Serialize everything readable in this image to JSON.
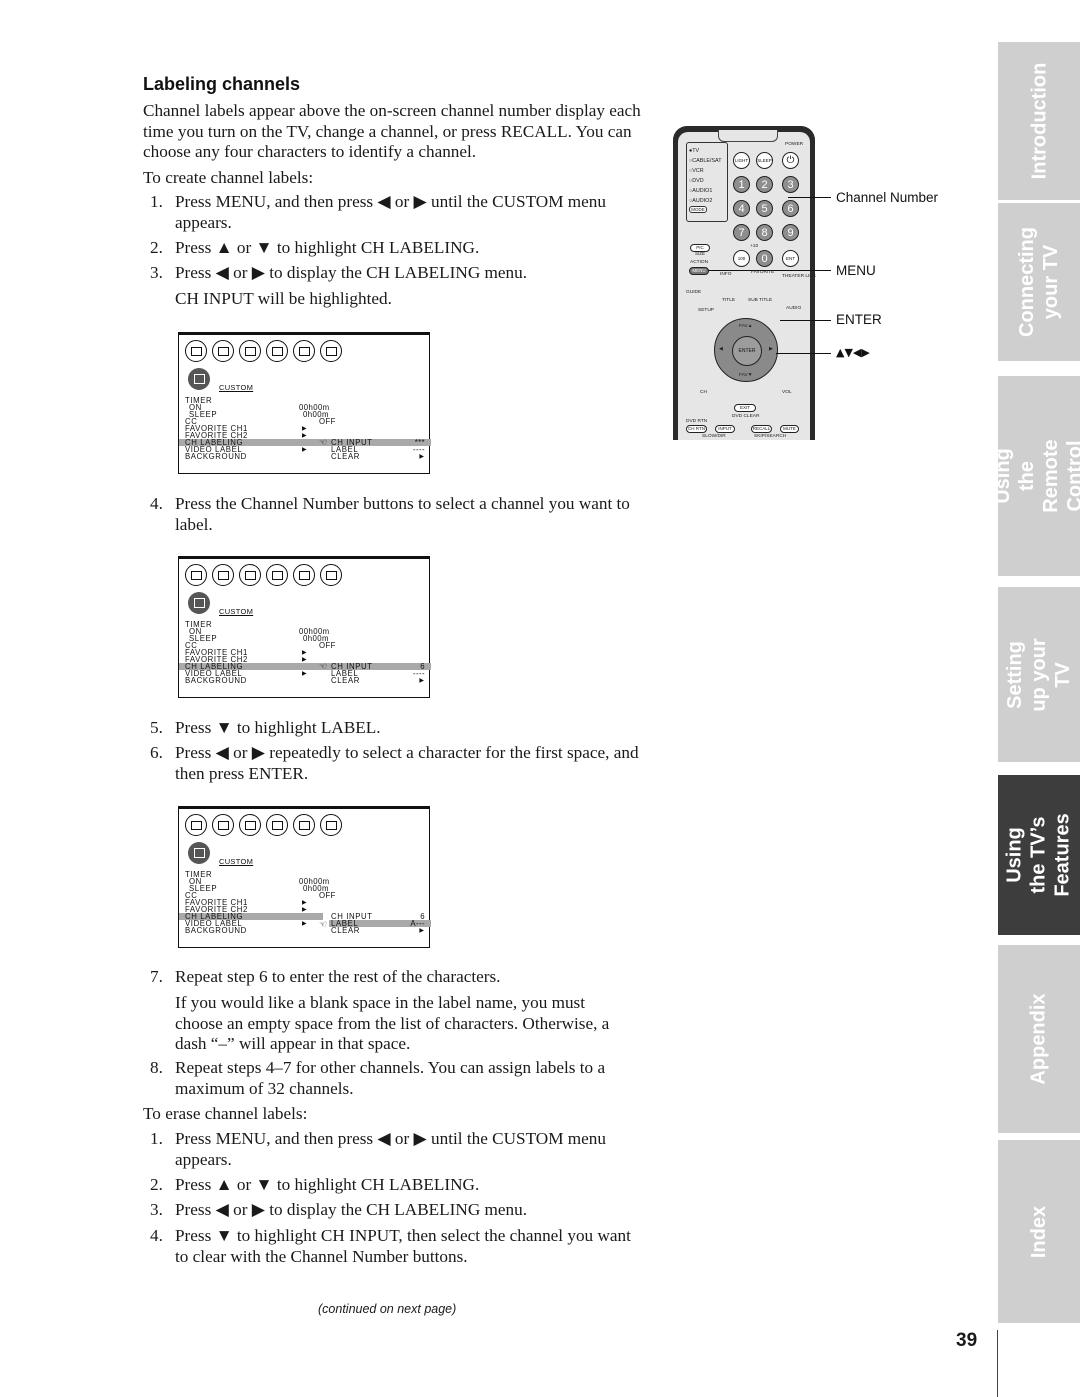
{
  "heading": "Labeling channels",
  "intro": "Channel labels appear above the on-screen channel number display each time you turn on the TV, change a channel, or press RECALL. You can choose any four characters to identify a channel.",
  "create_label": "To create channel labels:",
  "create_steps": [
    {
      "num": "1.",
      "text": "Press MENU, and then press ◀ or ▶ until the CUSTOM menu appears."
    },
    {
      "num": "2.",
      "text": "Press ▲ or ▼ to highlight CH LABELING."
    },
    {
      "num": "3.",
      "text": "Press ◀ or ▶ to display the CH LABELING menu."
    },
    {
      "num": "",
      "text": "CH INPUT will be highlighted."
    },
    {
      "num": "4.",
      "text": "Press the Channel Number buttons to select a channel you want to label."
    },
    {
      "num": "5.",
      "text": "Press ▼ to highlight LABEL."
    },
    {
      "num": "6.",
      "text": "Press ◀ or ▶ repeatedly to select a character for the first space, and then press ENTER."
    },
    {
      "num": "7.",
      "text": "Repeat step 6 to enter the rest of the characters."
    },
    {
      "num": "8.",
      "text": "Repeat steps 4–7 for other channels. You can assign labels to a maximum of 32 channels."
    }
  ],
  "step7_note": "If you would like a blank space in the label name, you must choose an empty space from the list of characters. Otherwise, a dash “–” will appear in that space.",
  "erase_label": "To erase channel labels:",
  "erase_steps": [
    {
      "num": "1.",
      "text": "Press MENU, and then press ◀ or ▶ until the CUSTOM menu appears."
    },
    {
      "num": "2.",
      "text": "Press ▲ or ▼ to highlight CH LABELING."
    },
    {
      "num": "3.",
      "text": "Press ◀ or ▶ to display the CH LABELING menu."
    },
    {
      "num": "4.",
      "text": "Press ▼ to highlight CH INPUT, then select the channel you want to clear with the Channel Number buttons."
    }
  ],
  "continued": "(continued on next page)",
  "page_number": "39",
  "osd_common": {
    "title": "CUSTOM",
    "rows": [
      "TIMER",
      "ON",
      "SLEEP",
      "CC",
      "FAVORITE CH1",
      "FAVORITE CH2",
      "CH LABELING",
      "VIDEO LABEL",
      "BACKGROUND"
    ],
    "on_value": "00h00m",
    "sleep_value": "0h00m",
    "cc_value": "OFF",
    "sub_items": [
      "CH INPUT",
      "LABEL",
      "CLEAR"
    ]
  },
  "osd_screens": [
    {
      "ch_input_value": "***",
      "label_value": "----",
      "selected": "CH INPUT"
    },
    {
      "ch_input_value": "6",
      "label_value": "----",
      "selected": "CH INPUT"
    },
    {
      "ch_input_value": "6",
      "label_value": "A---",
      "selected": "LABEL"
    }
  ],
  "remote": {
    "modes": [
      "●TV",
      "○CABLE/SAT",
      "○VCR",
      "○DVD",
      "○AUDIO1",
      "○AUDIO2"
    ],
    "mode_btn": "MODE",
    "light": "LIGHT",
    "sleep": "SLEEP",
    "power": "POWER",
    "digits": [
      "1",
      "2",
      "3",
      "4",
      "5",
      "6",
      "7",
      "8",
      "9"
    ],
    "pic_size": "PIC SIZE",
    "hundred": "100",
    "plus10": "+10",
    "zero": "0",
    "ent": "ENT",
    "action": "ACTION",
    "menu": "MENU",
    "info": "INFO",
    "favorite": "FAVORITE",
    "theater": "THEATER LINK",
    "guide": "GUIDE",
    "setup": "SETUP",
    "title": "TITLE",
    "subtitle": "SUB TITLE",
    "audio": "AUDIO",
    "fav_up": "FAV▲",
    "fav_down": "FAV▼",
    "enter": "ENTER",
    "ch": "CH",
    "vol": "VOL",
    "exit": "EXIT",
    "dvd_clear": "DVD CLEAR",
    "dvd_rtn": "DVD RTN",
    "ch_rtn": "CH RTN",
    "input": "INPUT",
    "recall": "RECALL",
    "mute": "MUTE",
    "slow_dir": "SLOW/DIR",
    "skip_search": "SKIP/SEARCH"
  },
  "callouts": {
    "channel_number": "Channel Number",
    "menu": "MENU",
    "enter": "ENTER",
    "arrows": "▲▼◀▶"
  },
  "side_tabs": [
    {
      "label": "Introduction",
      "active": false
    },
    {
      "label": "Connecting your TV",
      "active": false
    },
    {
      "label": "Using the Remote Control",
      "active": false
    },
    {
      "label": "Setting up your TV",
      "active": false
    },
    {
      "label": "Using the TV’s Features",
      "active": true
    },
    {
      "label": "Appendix",
      "active": false
    },
    {
      "label": "Index",
      "active": false
    }
  ],
  "colors": {
    "tab_inactive": "#cfcfcf",
    "tab_active": "#3d3d3d",
    "menu_highlight": "#a9a9a9"
  }
}
